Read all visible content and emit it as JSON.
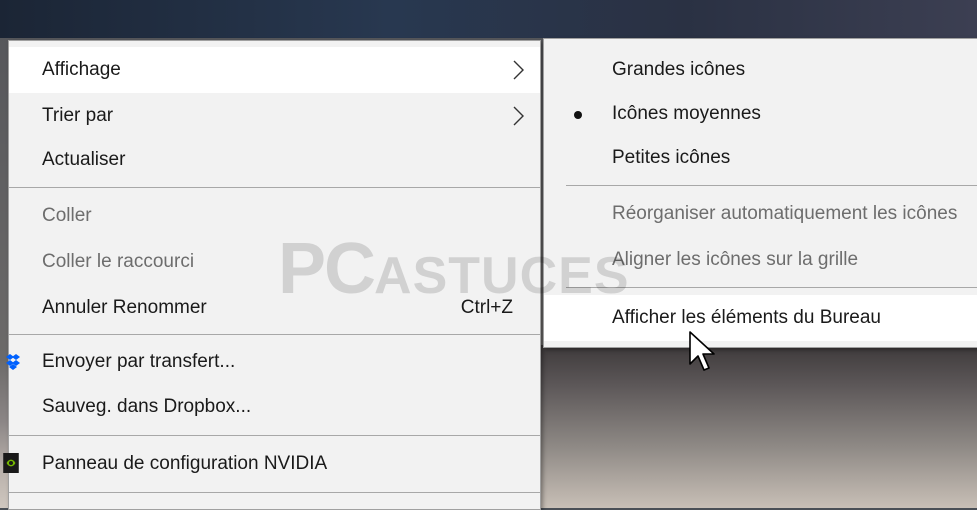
{
  "context_menu": {
    "items": [
      {
        "label": "Affichage",
        "has_submenu": true,
        "hovered": true
      },
      {
        "label": "Trier par",
        "has_submenu": true
      },
      {
        "label": "Actualiser"
      },
      {
        "label": "Coller",
        "disabled": true
      },
      {
        "label": "Coller le raccourci",
        "disabled": true
      },
      {
        "label": "Annuler Renommer",
        "shortcut": "Ctrl+Z"
      },
      {
        "label": "Envoyer par transfert...",
        "icon": "dropbox-icon"
      },
      {
        "label": "Sauveg. dans Dropbox..."
      },
      {
        "label": "Panneau de configuration NVIDIA",
        "icon": "nvidia-icon"
      }
    ]
  },
  "submenu": {
    "items": [
      {
        "label": "Grandes icônes"
      },
      {
        "label": "Icônes moyennes",
        "selected": true
      },
      {
        "label": "Petites icônes"
      },
      {
        "label": "Réorganiser automatiquement les icônes",
        "disabled": true
      },
      {
        "label": "Aligner les icônes sur la grille",
        "disabled": true
      },
      {
        "label": "Afficher les éléments du Bureau",
        "hovered": true
      }
    ]
  },
  "watermark": {
    "big": "PC",
    "small": "ASTUCES"
  },
  "colors": {
    "menu_bg": "#f2f2f2",
    "hover_bg": "#ffffff",
    "disabled_text": "#6d6d6d",
    "dropbox": "#0061fe",
    "nvidia": "#76b900"
  }
}
